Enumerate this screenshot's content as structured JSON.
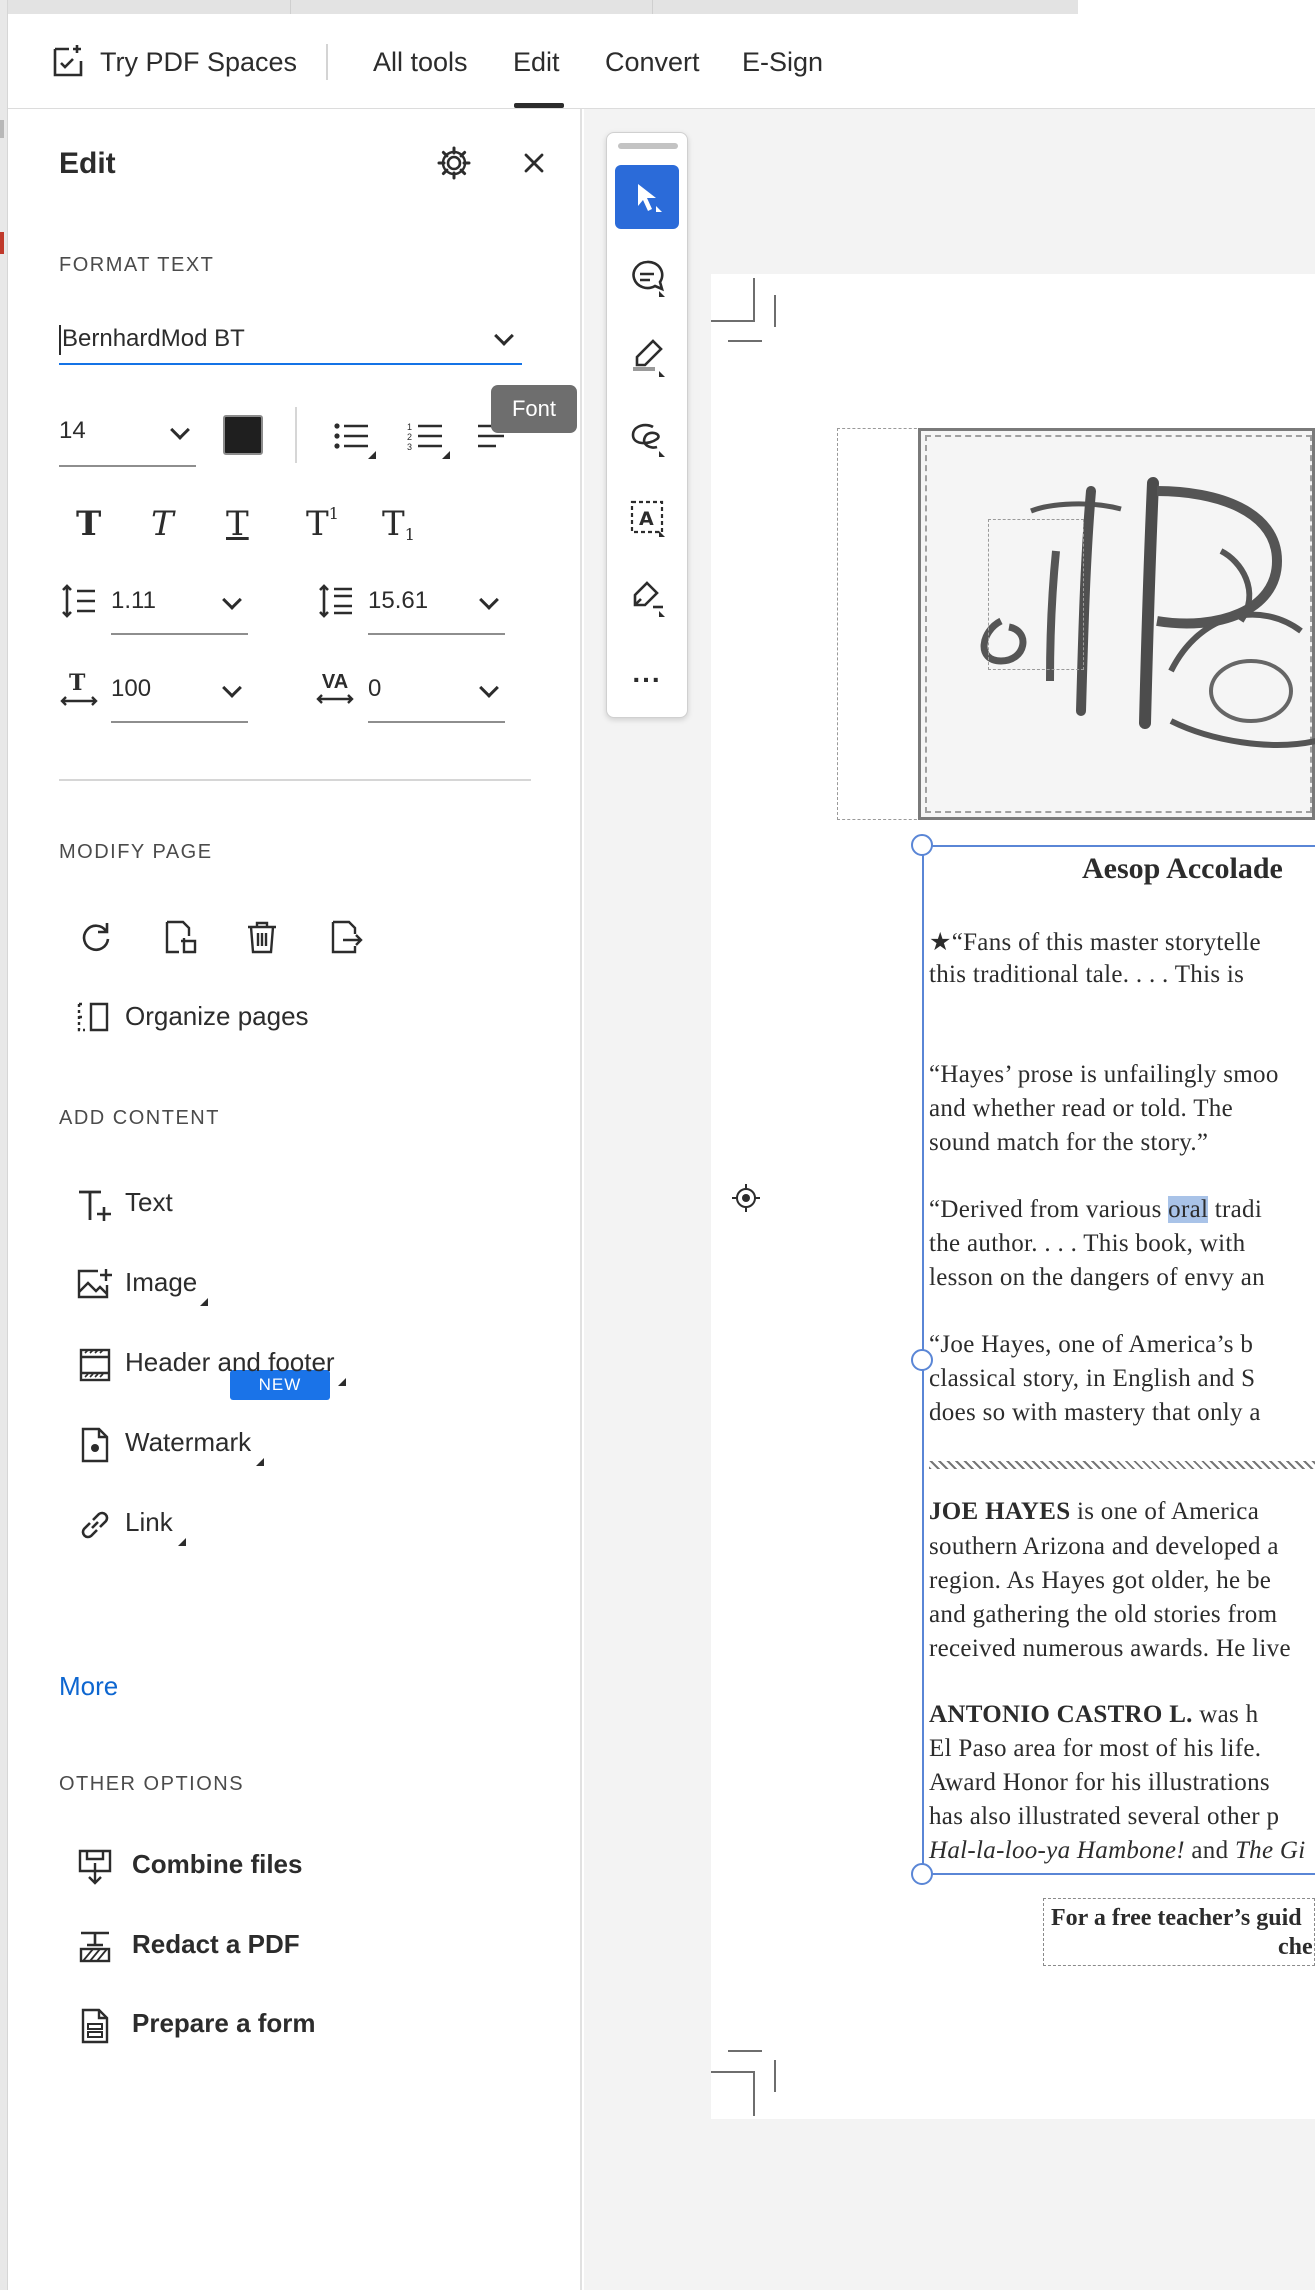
{
  "nav": {
    "spaces_label": "Try PDF Spaces",
    "all_tools": "All tools",
    "edit": "Edit",
    "convert": "Convert",
    "esign": "E-Sign"
  },
  "panel": {
    "title": "Edit",
    "format_text": {
      "heading": "FORMAT TEXT",
      "font_value": "BernhardMod BT",
      "size_value": "14",
      "text_color": "#1f1f1f",
      "line_spacing": "1.11",
      "paragraph_spacing": "15.61",
      "horizontal_scale": "100",
      "character_spacing": "0",
      "spacing_icon_label": "VA"
    },
    "modify_page": {
      "heading": "MODIFY PAGE",
      "organize": "Organize pages"
    },
    "add_content": {
      "heading": "ADD CONTENT",
      "text": "Text",
      "image": "Image",
      "badge": "NEW",
      "header_footer": "Header and footer",
      "watermark": "Watermark",
      "link": "Link",
      "more": "More"
    },
    "other_options": {
      "heading": "OTHER OPTIONS",
      "combine": "Combine files",
      "redact": "Redact a PDF",
      "prepare": "Prepare a form"
    }
  },
  "tooltip": "Font",
  "toolbar": {
    "more": "..."
  },
  "document": {
    "heading": "Aesop Accolade",
    "lines": [
      "★“Fans of this master storytelle",
      "this traditional tale. . . . This is",
      "“Hayes’ prose is unfailingly smoo",
      "and whether read or told. The",
      "sound match for the story.”",
      "“Derived from various ",
      "oral",
      " tradi",
      "the author. . . . This book, with",
      "lesson on the dangers of envy an",
      "“Joe Hayes, one of America’s b",
      "classical story, in English and S",
      "does so with mastery that only a",
      "JOE HAYES",
      " is one of America",
      "southern Arizona and developed a",
      "region. As Hayes got older, he be",
      "and gathering the old stories from",
      "received numerous awards. He live",
      "ANTONIO CASTRO L.",
      " was h",
      "El Paso area for most of his life.",
      "Award Honor for his illustrations",
      "has also illustrated several other p",
      "Hal-la-loo-ya Hambone!",
      " and ",
      "The Gi"
    ],
    "footer_line1": "For a free teacher’s guid",
    "footer_line2": "che"
  }
}
